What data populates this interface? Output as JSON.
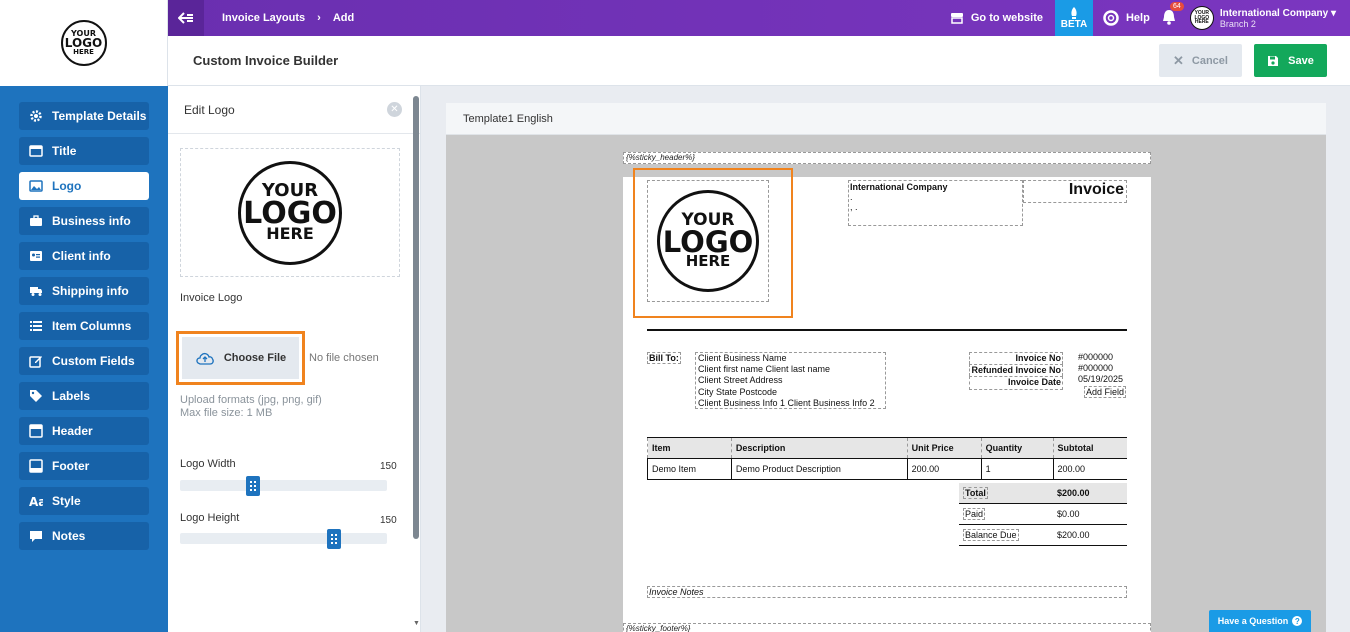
{
  "brand_logo": {
    "line1": "YOUR",
    "line2": "LOGO",
    "line3": "HERE"
  },
  "topbar": {
    "breadcrumb": [
      "Invoice Layouts",
      "Add"
    ],
    "go_to_website": "Go to website",
    "beta": "BETA",
    "help": "Help",
    "notification_count": "64",
    "company_name": "International Company",
    "branch": "Branch 2"
  },
  "page": {
    "title": "Custom Invoice Builder",
    "cancel_label": "Cancel",
    "save_label": "Save"
  },
  "sidebar": {
    "items": [
      {
        "label": "Template Details",
        "icon": "gear-icon",
        "active": false
      },
      {
        "label": "Title",
        "icon": "title-icon",
        "active": false
      },
      {
        "label": "Logo",
        "icon": "image-icon",
        "active": true
      },
      {
        "label": "Business info",
        "icon": "briefcase-icon",
        "active": false
      },
      {
        "label": "Client info",
        "icon": "id-card-icon",
        "active": false
      },
      {
        "label": "Shipping info",
        "icon": "truck-icon",
        "active": false
      },
      {
        "label": "Item Columns",
        "icon": "list-icon",
        "active": false
      },
      {
        "label": "Custom Fields",
        "icon": "edit-icon",
        "active": false
      },
      {
        "label": "Labels",
        "icon": "tag-icon",
        "active": false
      },
      {
        "label": "Header",
        "icon": "header-icon",
        "active": false
      },
      {
        "label": "Footer",
        "icon": "footer-icon",
        "active": false
      },
      {
        "label": "Style",
        "icon": "font-icon",
        "active": false
      },
      {
        "label": "Notes",
        "icon": "comment-icon",
        "active": false
      }
    ]
  },
  "edit_panel": {
    "title": "Edit Logo",
    "invoice_logo_label": "Invoice Logo",
    "choose_file": "Choose File",
    "no_file": "No file chosen",
    "hint_formats": "Upload formats (jpg, png, gif)",
    "hint_size": "Max file size: 1 MB",
    "logo_width_label": "Logo Width",
    "logo_width_value": "150",
    "logo_width_fraction": 0.34,
    "logo_height_label": "Logo Height",
    "logo_height_value": "150",
    "logo_height_fraction": 0.76
  },
  "preview": {
    "template_name": "Template1 English",
    "sticky_header": "{%sticky_header%}",
    "sticky_footer": "{%sticky_footer%}",
    "company_name": "International Company",
    "company_line2": ".",
    "company_line3": ", .",
    "invoice_title": "Invoice",
    "bill_to": "Bill To:",
    "client_lines": [
      "Client Business Name",
      "Client first name Client last name",
      "Client Street Address",
      "City State Postcode",
      "Client Business Info 1 Client Business Info 2"
    ],
    "meta_labels": [
      "Invoice No",
      "Refunded Invoice No",
      "Invoice Date"
    ],
    "meta_values": [
      "#000000",
      "#000000",
      "05/19/2025"
    ],
    "add_field": "Add Field",
    "columns": [
      "Item",
      "Description",
      "Unit Price",
      "Quantity",
      "Subtotal"
    ],
    "rows": [
      [
        "Demo Item",
        "Demo Product Description",
        "200.00",
        "1",
        "200.00"
      ]
    ],
    "totals": [
      {
        "label": "Total",
        "value": "$200.00"
      },
      {
        "label": "Paid",
        "value": "$0.00"
      },
      {
        "label": "Balance Due",
        "value": "$200.00"
      }
    ],
    "notes": "Invoice Notes"
  },
  "help_button": "Have a Question"
}
